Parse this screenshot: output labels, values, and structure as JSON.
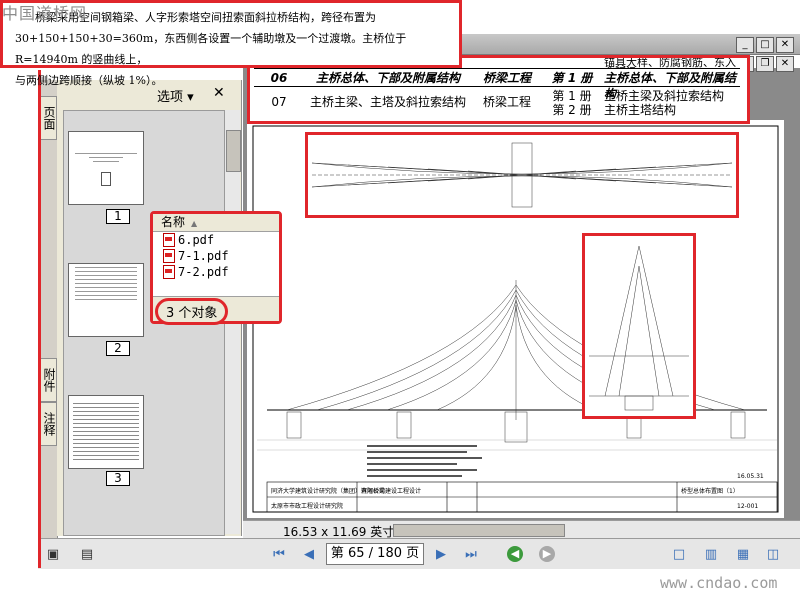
{
  "watermark": {
    "logo": "中国道桥网",
    "footer": "www.cndao.com"
  },
  "overlay_text": [
    "桥梁采用空间钢箱梁、人字形索塔空间扭索面斜拉桥结构，跨径布置为",
    "30+150+150+30=360m，东西侧各设置一个辅助墩及一个过渡墩。主桥位于 R=14940m 的竖曲线上，",
    "与两侧边跨顺接（纵坡 1%）。"
  ],
  "window_buttons": {
    "minimize": "_",
    "maximize": "□",
    "close": "✕",
    "restore": "❐"
  },
  "nav": {
    "tabs": [
      "页面",
      "附件",
      "注释"
    ],
    "options_label": "选项 ▾",
    "close_label": "✕",
    "thumbnails": [
      {
        "label": "1"
      },
      {
        "label": "2"
      },
      {
        "label": "3"
      }
    ]
  },
  "popup": {
    "header": "名称",
    "files": [
      "6.pdf",
      "7-1.pdf",
      "7-2.pdf"
    ],
    "status": "3 个对象"
  },
  "doc_table": {
    "top_fragment": "锚具大样、防腐钢筋、东入非稠梁",
    "rows": [
      {
        "no": "06",
        "title": "主桥总体、下部及附属结构",
        "category": "桥梁工程",
        "volume": "第 1 册",
        "sub": "主桥总体、下部及附属结构",
        "italic": true
      },
      {
        "no": "07",
        "title": "主桥主梁、主塔及斜拉索结构",
        "category": "桥梁工程",
        "volume": "第 1 册",
        "sub": "主桥主梁及斜拉索结构",
        "italic": false
      },
      {
        "no": "",
        "title": "",
        "category": "",
        "volume": "第 2 册",
        "sub": "主桥主塔结构",
        "italic": false
      }
    ]
  },
  "drawing": {
    "institutes": [
      "同济大学建筑设计研究院（集团）有限公司",
      "太原市市政工程设计研究院"
    ],
    "project": "滨河桥梁建设工程设计",
    "sheet_title": "桥型总体布置图（1）",
    "sheet_no": "12-001",
    "date": "16.05.31"
  },
  "doc_status": {
    "page_size": "16.53 x 11.69 英寸"
  },
  "toolbar": {
    "page_display": "第 65 / 180 页",
    "first": "⏮",
    "prev": "◀",
    "next": "▶",
    "last": "⏭"
  }
}
